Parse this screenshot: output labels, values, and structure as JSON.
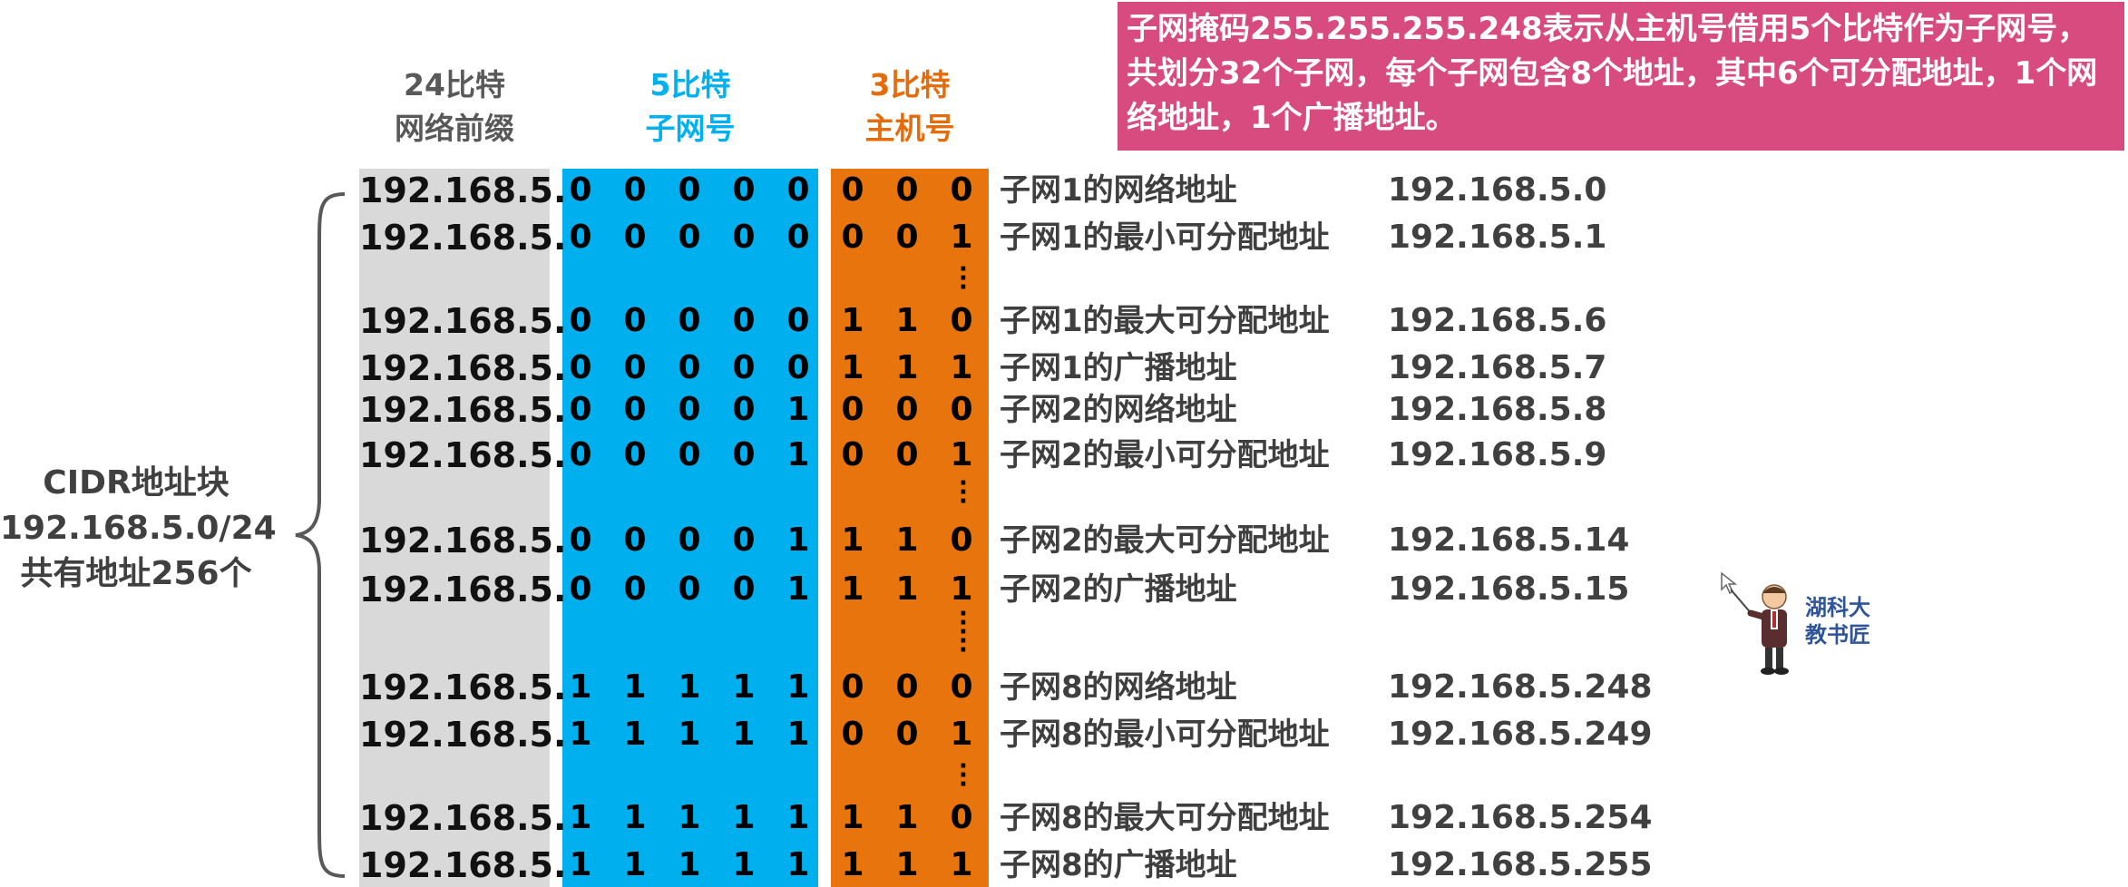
{
  "headers": {
    "prefix": [
      "24比特",
      "网络前缀"
    ],
    "subnet": [
      "5比特",
      "子网号"
    ],
    "host": [
      "3比特",
      "主机号"
    ]
  },
  "note": "子网掩码255.255.255.248表示从主机号借用5个比特作为子网号，共划分32个子网，每个子网包含8个地址，其中6个可分配地址，1个网络地址，1个广播地址。",
  "cidr": [
    "CIDR地址块",
    "192.168.5.0/24",
    "共有地址256个"
  ],
  "colors": {
    "prefix": "#d9d9d9",
    "subnet": "#00b0ee",
    "host": "#e8740e",
    "note": "#d84b7e"
  },
  "rows": [
    {
      "prefix": "192.168.5.",
      "subnet_bits": [
        "0",
        "0",
        "0",
        "0",
        "0"
      ],
      "host_bits": [
        "0",
        "0",
        "0"
      ],
      "desc": "子网1的网络地址",
      "addr": "192.168.5.0"
    },
    {
      "prefix": "192.168.5.",
      "subnet_bits": [
        "0",
        "0",
        "0",
        "0",
        "0"
      ],
      "host_bits": [
        "0",
        "0",
        "1"
      ],
      "desc": "子网1的最小可分配地址",
      "addr": "192.168.5.1"
    },
    {
      "prefix": "192.168.5.",
      "subnet_bits": [
        "0",
        "0",
        "0",
        "0",
        "0"
      ],
      "host_bits": [
        "1",
        "1",
        "0"
      ],
      "desc": "子网1的最大可分配地址",
      "addr": "192.168.5.6"
    },
    {
      "prefix": "192.168.5.",
      "subnet_bits": [
        "0",
        "0",
        "0",
        "0",
        "0"
      ],
      "host_bits": [
        "1",
        "1",
        "1"
      ],
      "desc": "子网1的广播地址",
      "addr": "192.168.5.7"
    },
    {
      "prefix": "192.168.5.",
      "subnet_bits": [
        "0",
        "0",
        "0",
        "0",
        "1"
      ],
      "host_bits": [
        "0",
        "0",
        "0"
      ],
      "desc": "子网2的网络地址",
      "addr": "192.168.5.8"
    },
    {
      "prefix": "192.168.5.",
      "subnet_bits": [
        "0",
        "0",
        "0",
        "0",
        "1"
      ],
      "host_bits": [
        "0",
        "0",
        "1"
      ],
      "desc": "子网2的最小可分配地址",
      "addr": "192.168.5.9"
    },
    {
      "prefix": "192.168.5.",
      "subnet_bits": [
        "0",
        "0",
        "0",
        "0",
        "1"
      ],
      "host_bits": [
        "1",
        "1",
        "0"
      ],
      "desc": "子网2的最大可分配地址",
      "addr": "192.168.5.14"
    },
    {
      "prefix": "192.168.5.",
      "subnet_bits": [
        "0",
        "0",
        "0",
        "0",
        "1"
      ],
      "host_bits": [
        "1",
        "1",
        "1"
      ],
      "desc": "子网2的广播地址",
      "addr": "192.168.5.15"
    },
    {
      "prefix": "192.168.5.",
      "subnet_bits": [
        "1",
        "1",
        "1",
        "1",
        "1"
      ],
      "host_bits": [
        "0",
        "0",
        "0"
      ],
      "desc": "子网8的网络地址",
      "addr": "192.168.5.248"
    },
    {
      "prefix": "192.168.5.",
      "subnet_bits": [
        "1",
        "1",
        "1",
        "1",
        "1"
      ],
      "host_bits": [
        "0",
        "0",
        "1"
      ],
      "desc": "子网8的最小可分配地址",
      "addr": "192.168.5.249"
    },
    {
      "prefix": "192.168.5.",
      "subnet_bits": [
        "1",
        "1",
        "1",
        "1",
        "1"
      ],
      "host_bits": [
        "1",
        "1",
        "0"
      ],
      "desc": "子网8的最大可分配地址",
      "addr": "192.168.5.254"
    },
    {
      "prefix": "192.168.5.",
      "subnet_bits": [
        "1",
        "1",
        "1",
        "1",
        "1"
      ],
      "host_bits": [
        "1",
        "1",
        "1"
      ],
      "desc": "子网8的广播地址",
      "addr": "192.168.5.255"
    }
  ],
  "logo": [
    "湖科大",
    "教书匠"
  ]
}
